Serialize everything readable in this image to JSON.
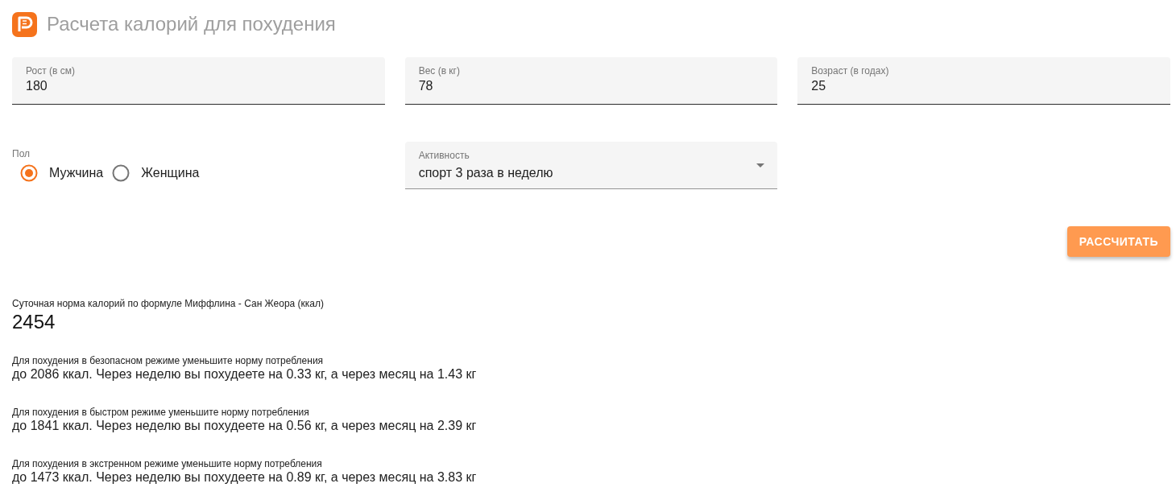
{
  "header": {
    "title": "Расчета калорий для похудения"
  },
  "fields": [
    {
      "label": "Рост (в см)",
      "value": "180"
    },
    {
      "label": "Вес (в кг)",
      "value": "78"
    },
    {
      "label": "Возраст (в годах)",
      "value": "25"
    }
  ],
  "gender": {
    "label": "Пол",
    "options": [
      {
        "label": "Мужчина",
        "selected": true
      },
      {
        "label": "Женщина",
        "selected": false
      }
    ]
  },
  "activity": {
    "label": "Активность",
    "value": "спорт 3 раза в неделю"
  },
  "calculate_button": "РАССЧИТАТЬ",
  "results": {
    "daily": {
      "label": "Суточная норма калорий по формуле Миффлина - Сан Жеора (ккал)",
      "value": "2454"
    },
    "plans": [
      {
        "label": "Для похудения в безопасном режиме уменьшите норму потребления",
        "text": "до 2086 ккал. Через неделю вы похудеете на 0.33 кг, а через месяц на 1.43 кг"
      },
      {
        "label": "Для похудения в быстром режиме уменьшите норму потребления",
        "text": "до 1841 ккал. Через неделю вы похудеете на 0.56 кг, а через месяц на 2.39 кг"
      },
      {
        "label": "Для похудения в экстренном режиме уменьшите норму потребления",
        "text": "до 1473 ккал. Через неделю вы похудеете на 0.89 кг, а через месяц на 3.83 кг"
      }
    ]
  }
}
